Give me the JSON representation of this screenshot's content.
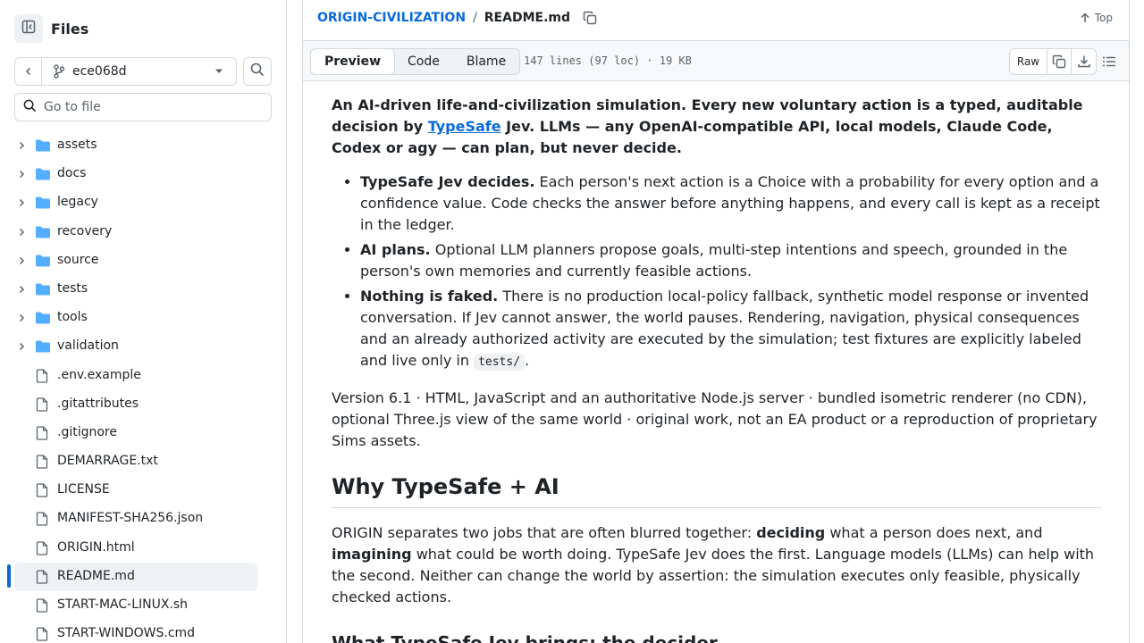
{
  "sidebar": {
    "title": "Files",
    "branch": "ece068d",
    "goto_placeholder": "Go to file",
    "folders": [
      "assets",
      "docs",
      "legacy",
      "recovery",
      "source",
      "tests",
      "tools",
      "validation"
    ],
    "files": [
      ".env.example",
      ".gitattributes",
      ".gitignore",
      "DEMARRAGE.txt",
      "LICENSE",
      "MANIFEST-SHA256.json",
      "ORIGIN.html",
      "README.md",
      "START-MAC-LINUX.sh",
      "START-WINDOWS.cmd"
    ],
    "selected_file": "README.md"
  },
  "header": {
    "repo": "ORIGIN-CIVILIZATION",
    "separator": "/",
    "file": "README.md",
    "top_label": "Top"
  },
  "toolbar": {
    "tabs": [
      "Preview",
      "Code",
      "Blame"
    ],
    "active_tab": "Preview",
    "file_info": "147 lines (97 loc) · 19 KB",
    "raw_label": "Raw"
  },
  "readme": {
    "intro_1": "An AI-driven life-and-civilization simulation. Every new voluntary action is a typed, auditable decision by ",
    "intro_link": "TypeSafe",
    "intro_2": " Jev. LLMs — any OpenAI-compatible API, local models, Claude Code, Codex or agy — can plan, but never decide.",
    "bullets": [
      {
        "bold": "TypeSafe Jev decides.",
        "text": " Each person's next action is a Choice with a probability for every option and a confidence value. Code checks the answer before anything happens, and every call is kept as a receipt in the ledger."
      },
      {
        "bold": "AI plans.",
        "text": " Optional LLM planners propose goals, multi-step intentions and speech, grounded in the person's own memories and currently feasible actions."
      },
      {
        "bold": "Nothing is faked.",
        "text": " There is no production local-policy fallback, synthetic model response or invented conversation. If Jev cannot answer, the world pauses. Rendering, navigation, physical consequences and an already authorized activity are executed by the simulation; test fixtures are explicitly labeled and live only in ",
        "code": "tests/",
        "tail": "."
      }
    ],
    "version_line": "Version 6.1 · HTML, JavaScript and an authoritative Node.js server · bundled isometric renderer (no CDN), optional Three.js view of the same world · original work, not an EA product or a reproduction of proprietary Sims assets.",
    "h2": "Why TypeSafe + AI",
    "why_1": "ORIGIN separates two jobs that are often blurred together: ",
    "why_b1": "deciding",
    "why_2": " what a person does next, and ",
    "why_b2": "imagining",
    "why_3": " what could be worth doing. TypeSafe Jev does the first. Language models (LLMs) can help with the second. Neither can change the world by assertion: the simulation executes only feasible, physically checked actions.",
    "h3": "What TypeSafe Jev brings: the decider"
  },
  "colors": {
    "accent": "#0969da",
    "folder": "#54aeff",
    "border": "#d1d9e0",
    "muted": "#59636e"
  }
}
